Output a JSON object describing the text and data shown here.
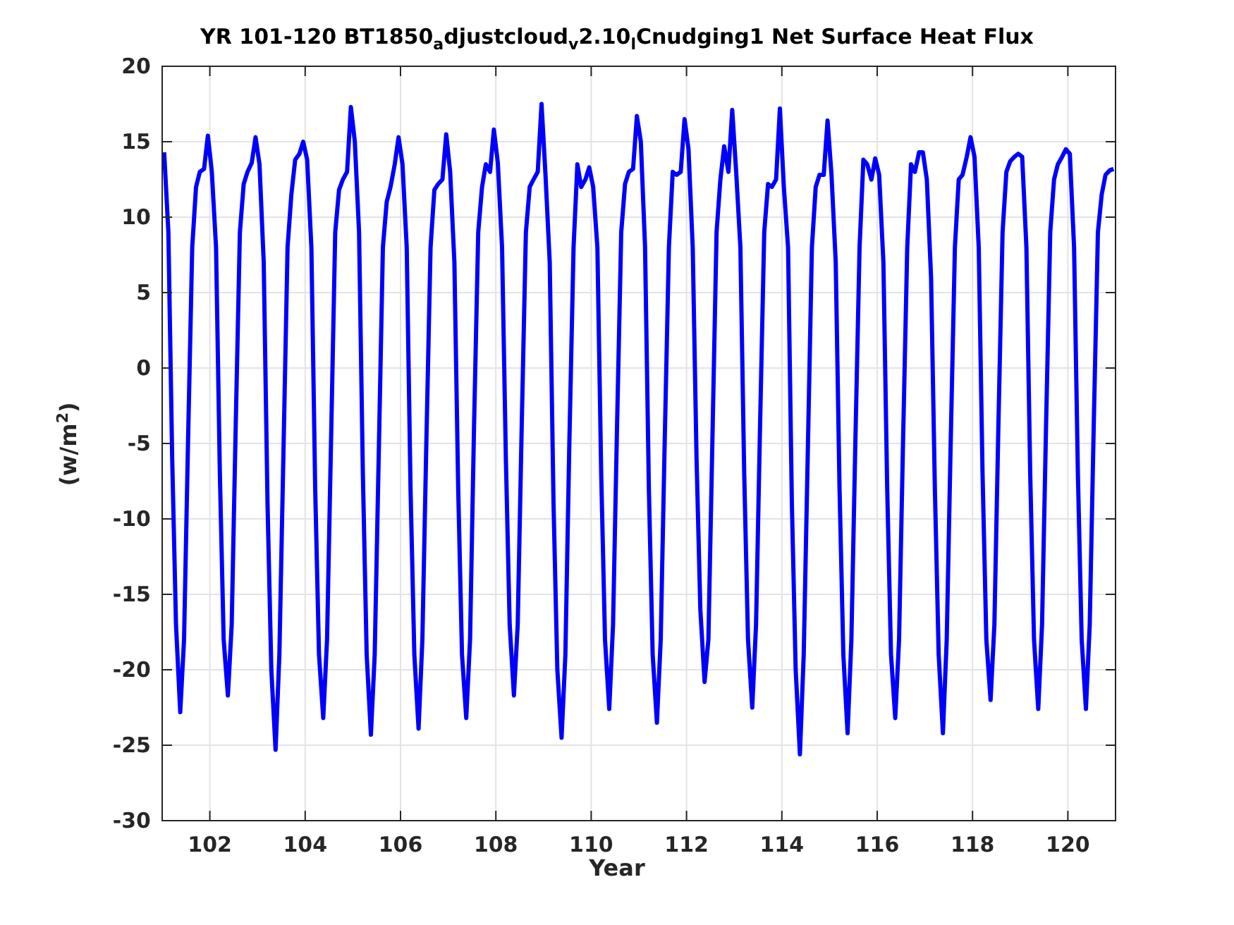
{
  "figure": {
    "chart_data": {
      "type": "line",
      "title": "YR 101-120 BT1850$_{a}$djustcloud$_{v}$2.10$_{l}$Cnudging1 Net Surface Heat Flux",
      "xlabel": "Year",
      "ylabel": "(w/m$^{2}$)",
      "xlim": [
        101,
        121
      ],
      "ylim": [
        -30,
        20
      ],
      "xticks": [
        102,
        104,
        106,
        108,
        110,
        112,
        114,
        116,
        118,
        120
      ],
      "grid": true,
      "yticks": [
        -30,
        -25,
        -20,
        -15,
        -10,
        -5,
        0,
        5,
        10,
        15,
        20
      ],
      "x": [
        101.04,
        101.13,
        101.21,
        101.29,
        101.38,
        101.46,
        101.54,
        101.63,
        101.71,
        101.79,
        101.88,
        101.96,
        102.04,
        102.13,
        102.21,
        102.29,
        102.38,
        102.46,
        102.54,
        102.63,
        102.71,
        102.79,
        102.88,
        102.96,
        103.04,
        103.13,
        103.21,
        103.29,
        103.38,
        103.46,
        103.54,
        103.63,
        103.71,
        103.79,
        103.88,
        103.96,
        104.04,
        104.13,
        104.21,
        104.29,
        104.38,
        104.46,
        104.54,
        104.63,
        104.71,
        104.79,
        104.88,
        104.96,
        105.04,
        105.13,
        105.21,
        105.29,
        105.38,
        105.46,
        105.54,
        105.63,
        105.71,
        105.79,
        105.88,
        105.96,
        106.04,
        106.13,
        106.21,
        106.29,
        106.38,
        106.46,
        106.54,
        106.63,
        106.71,
        106.79,
        106.88,
        106.96,
        107.04,
        107.13,
        107.21,
        107.29,
        107.38,
        107.46,
        107.54,
        107.63,
        107.71,
        107.79,
        107.88,
        107.96,
        108.04,
        108.13,
        108.21,
        108.29,
        108.38,
        108.46,
        108.54,
        108.63,
        108.71,
        108.79,
        108.88,
        108.96,
        109.04,
        109.13,
        109.21,
        109.29,
        109.38,
        109.46,
        109.54,
        109.63,
        109.71,
        109.79,
        109.88,
        109.96,
        110.04,
        110.13,
        110.21,
        110.29,
        110.38,
        110.46,
        110.54,
        110.63,
        110.71,
        110.79,
        110.88,
        110.96,
        111.04,
        111.13,
        111.21,
        111.29,
        111.38,
        111.46,
        111.54,
        111.63,
        111.71,
        111.79,
        111.88,
        111.96,
        112.04,
        112.13,
        112.21,
        112.29,
        112.38,
        112.46,
        112.54,
        112.63,
        112.71,
        112.79,
        112.88,
        112.96,
        113.04,
        113.13,
        113.21,
        113.29,
        113.38,
        113.46,
        113.54,
        113.63,
        113.71,
        113.79,
        113.88,
        113.96,
        114.04,
        114.13,
        114.21,
        114.29,
        114.38,
        114.46,
        114.54,
        114.63,
        114.71,
        114.79,
        114.88,
        114.96,
        115.04,
        115.13,
        115.21,
        115.29,
        115.38,
        115.46,
        115.54,
        115.63,
        115.71,
        115.79,
        115.88,
        115.96,
        116.04,
        116.13,
        116.21,
        116.29,
        116.38,
        116.46,
        116.54,
        116.63,
        116.71,
        116.79,
        116.88,
        116.96,
        117.04,
        117.13,
        117.21,
        117.29,
        117.38,
        117.46,
        117.54,
        117.63,
        117.71,
        117.79,
        117.88,
        117.96,
        118.04,
        118.13,
        118.21,
        118.29,
        118.38,
        118.46,
        118.54,
        118.63,
        118.71,
        118.79,
        118.88,
        118.96,
        119.04,
        119.13,
        119.21,
        119.29,
        119.38,
        119.46,
        119.54,
        119.63,
        119.71,
        119.79,
        119.88,
        119.96,
        120.04,
        120.13,
        120.21,
        120.29,
        120.38,
        120.46,
        120.54,
        120.63,
        120.71,
        120.79,
        120.88,
        120.96
      ],
      "series": [
        {
          "color": "#0000ff",
          "values": [
            14.3,
            9,
            -6,
            -17,
            -22.8,
            -18,
            -5,
            8,
            12,
            13,
            13.2,
            15.4,
            13,
            8,
            -7,
            -18,
            -21.7,
            -17,
            -4,
            9,
            12.2,
            13,
            13.6,
            15.3,
            13.5,
            7,
            -9,
            -20,
            -25.3,
            -19,
            -6,
            8,
            11.5,
            13.8,
            14.2,
            15,
            13.8,
            8,
            -8,
            -19,
            -23.2,
            -18,
            -5,
            9,
            11.8,
            12.5,
            13,
            17.3,
            15,
            9,
            -7,
            -19,
            -24.3,
            -19,
            -6,
            8,
            11,
            12,
            13.5,
            15.3,
            13.5,
            8,
            -8,
            -19,
            -23.9,
            -18,
            -5,
            8,
            11.8,
            12.2,
            12.5,
            15.5,
            13,
            7,
            -8,
            -19,
            -23.2,
            -18,
            -4,
            9,
            12,
            13.5,
            13,
            15.8,
            13.6,
            8,
            -6,
            -17,
            -21.7,
            -17,
            -4,
            9,
            12,
            12.5,
            13,
            17.5,
            12.8,
            7,
            -9,
            -20,
            -24.5,
            -19,
            -5,
            8,
            13.5,
            12,
            12.5,
            13.3,
            12,
            8,
            -7,
            -18,
            -22.6,
            -17,
            -4,
            9,
            12.2,
            13,
            13.2,
            16.7,
            15,
            8,
            -8,
            -19,
            -23.5,
            -18,
            -5,
            8,
            13,
            12.8,
            13,
            16.5,
            14.5,
            8,
            -6,
            -16,
            -20.8,
            -18,
            -5,
            9,
            12.5,
            14.7,
            13,
            17.1,
            13,
            8,
            -7,
            -18,
            -22.5,
            -17,
            -4,
            9,
            12.2,
            12,
            12.5,
            17.2,
            12,
            8,
            -9,
            -20,
            -25.6,
            -19,
            -6,
            8,
            12,
            12.8,
            12.8,
            16.4,
            12.8,
            7,
            -8,
            -19,
            -24.2,
            -18,
            -5,
            8,
            13.8,
            13.5,
            12.5,
            13.9,
            12.8,
            7,
            -8,
            -19,
            -23.2,
            -18,
            -5,
            8,
            13.5,
            13,
            14.3,
            14.3,
            12.5,
            6,
            -8,
            -19,
            -24.2,
            -18,
            -5,
            8,
            12.5,
            12.8,
            14,
            15.3,
            14,
            8,
            -7,
            -18,
            -22,
            -17,
            -4,
            9,
            13,
            13.7,
            14,
            14.2,
            14,
            8,
            -7,
            -18,
            -22.6,
            -17,
            -4,
            9,
            12.5,
            13.5,
            14,
            14.5,
            14.2,
            8,
            -7,
            -18,
            -22.6,
            -17,
            -4,
            9,
            11.5,
            12.8,
            13.1,
            13.2
          ]
        }
      ]
    }
  }
}
